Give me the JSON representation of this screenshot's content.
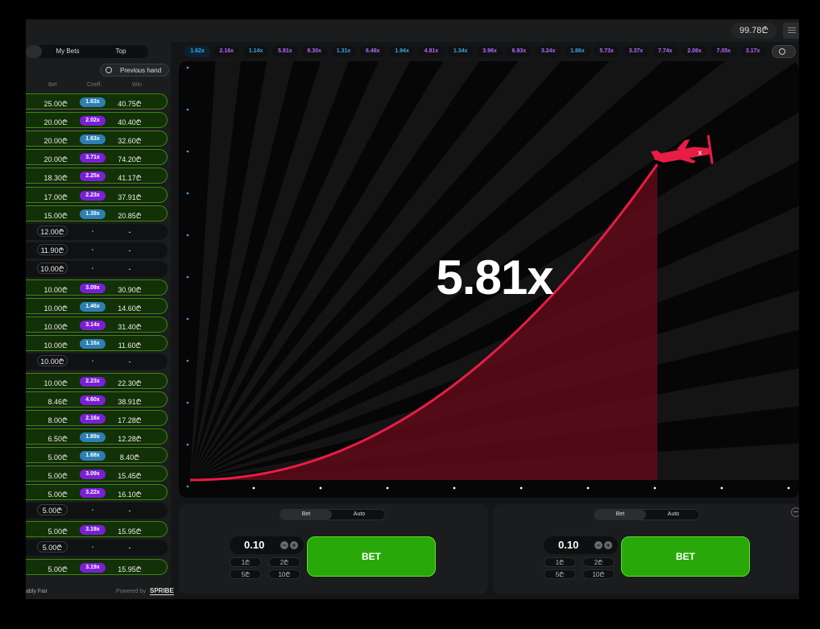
{
  "header": {
    "balance": "99.78₾"
  },
  "left_tabs": {
    "all": "",
    "my_bets": "My Bets",
    "top": "Top"
  },
  "previous_hand": "Previous hand",
  "columns": {
    "bet": "Bet",
    "coeff": "Coeff.",
    "win": "Win"
  },
  "bets": [
    {
      "bet": "25.00₾",
      "coeff": "1.63x",
      "win": "40.75₾",
      "won": true
    },
    {
      "bet": "20.00₾",
      "coeff": "2.02x",
      "win": "40.40₾",
      "won": true
    },
    {
      "bet": "20.00₾",
      "coeff": "1.63x",
      "win": "32.60₾",
      "won": true
    },
    {
      "bet": "20.00₾",
      "coeff": "3.71x",
      "win": "74.20₾",
      "won": true
    },
    {
      "bet": "18.30₾",
      "coeff": "2.25x",
      "win": "41.17₾",
      "won": true
    },
    {
      "bet": "17.00₾",
      "coeff": "2.23x",
      "win": "37.91₾",
      "won": true
    },
    {
      "bet": "15.00₾",
      "coeff": "1.39x",
      "win": "20.85₾",
      "won": true
    },
    {
      "bet": "12.00₾",
      "coeff": "-",
      "win": "-",
      "won": false
    },
    {
      "bet": "11.90₾",
      "coeff": "-",
      "win": "-",
      "won": false
    },
    {
      "bet": "10.00₾",
      "coeff": "-",
      "win": "-",
      "won": false
    },
    {
      "bet": "10.00₾",
      "coeff": "3.09x",
      "win": "30.90₾",
      "won": true
    },
    {
      "bet": "10.00₾",
      "coeff": "1.46x",
      "win": "14.60₾",
      "won": true
    },
    {
      "bet": "10.00₾",
      "coeff": "3.14x",
      "win": "31.40₾",
      "won": true
    },
    {
      "bet": "10.00₾",
      "coeff": "1.16x",
      "win": "11.60₾",
      "won": true
    },
    {
      "bet": "10.00₾",
      "coeff": "-",
      "win": "-",
      "won": false
    },
    {
      "bet": "10.00₾",
      "coeff": "2.23x",
      "win": "22.30₾",
      "won": true
    },
    {
      "bet": "8.46₾",
      "coeff": "4.60x",
      "win": "38.91₾",
      "won": true
    },
    {
      "bet": "8.00₾",
      "coeff": "2.16x",
      "win": "17.28₾",
      "won": true
    },
    {
      "bet": "6.50₾",
      "coeff": "1.89x",
      "win": "12.28₾",
      "won": true
    },
    {
      "bet": "5.00₾",
      "coeff": "1.68x",
      "win": "8.40₾",
      "won": true
    },
    {
      "bet": "5.00₾",
      "coeff": "3.09x",
      "win": "15.45₾",
      "won": true
    },
    {
      "bet": "5.00₾",
      "coeff": "3.22x",
      "win": "16.10₾",
      "won": true
    },
    {
      "bet": "5.00₾",
      "coeff": "-",
      "win": "-",
      "won": false
    },
    {
      "bet": "5.00₾",
      "coeff": "3.19x",
      "win": "15.95₾",
      "won": true
    },
    {
      "bet": "5.00₾",
      "coeff": "-",
      "win": "-",
      "won": false
    },
    {
      "bet": "5.00₾",
      "coeff": "3.19x",
      "win": "15.95₾",
      "won": true
    }
  ],
  "footer": {
    "provably_fair": "ably Fair",
    "powered_by": "Powered by",
    "brand": "SPRIBE"
  },
  "history": [
    "1.62x",
    "2.16x",
    "1.14x",
    "5.81x",
    "9.30x",
    "1.31x",
    "6.48x",
    "1.94x",
    "4.81x",
    "1.34x",
    "3.96x",
    "6.93x",
    "3.24x",
    "1.86x",
    "5.73x",
    "3.37x",
    "7.74x",
    "2.08x",
    "7.05x",
    "3.17x"
  ],
  "colors": {
    "low": "#2d7fb3",
    "mid": "#7b1fd6",
    "high": "#c0178b",
    "win_row": "#123107",
    "curve": "#e81d45",
    "fill": "#5a0b17",
    "bet_button": "#28a909"
  },
  "game": {
    "multiplier": "5.81x",
    "progress_fraction": 0.81
  },
  "bet_panels": [
    {
      "tab_bet": "Bet",
      "tab_auto": "Auto",
      "amount": "0.10",
      "quick": [
        "1₾",
        "2₾",
        "5₾",
        "10₾"
      ],
      "button": "BET"
    },
    {
      "tab_bet": "Bet",
      "tab_auto": "Auto",
      "amount": "0.10",
      "quick": [
        "1₾",
        "2₾",
        "5₾",
        "10₾"
      ],
      "button": "BET"
    }
  ],
  "icons": {
    "history": "history-icon",
    "menu": "menu-icon",
    "plane": "plane-icon",
    "minus": "minus-icon",
    "plus": "plus-icon"
  }
}
